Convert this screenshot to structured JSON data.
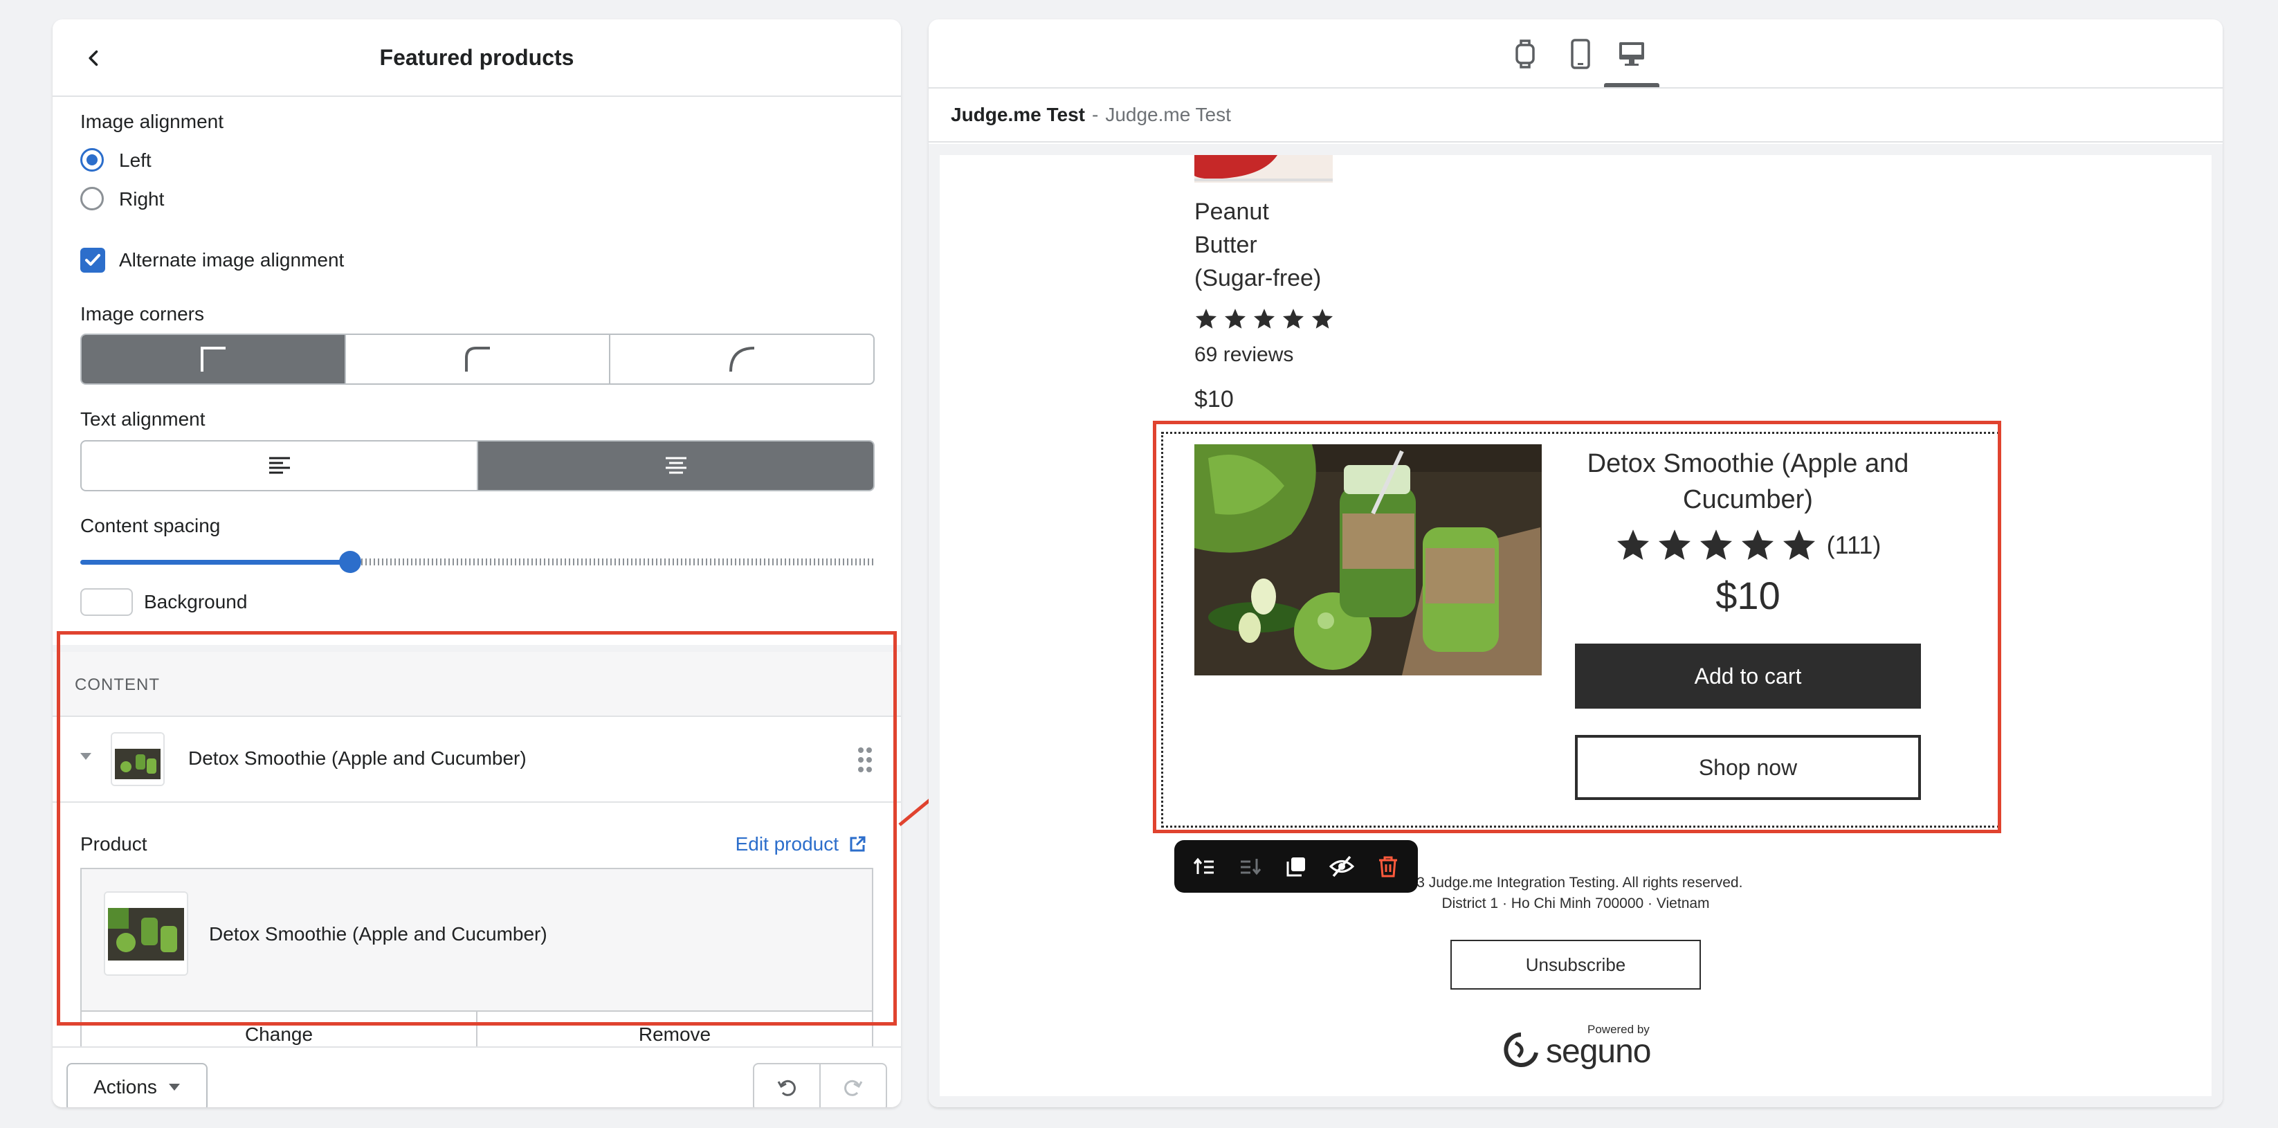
{
  "panel": {
    "title": "Featured products",
    "image_alignment": {
      "label": "Image alignment",
      "options": [
        "Left",
        "Right"
      ],
      "selected": "Left"
    },
    "alternate": {
      "label": "Alternate image alignment",
      "checked": true
    },
    "image_corners": {
      "label": "Image corners",
      "selected": 0
    },
    "text_alignment": {
      "label": "Text alignment",
      "selected": 1
    },
    "content_spacing": {
      "label": "Content spacing",
      "value": 0.34
    },
    "background": {
      "label": "Background",
      "color": "#ffffff"
    },
    "content": {
      "title": "CONTENT",
      "item_name": "Detox Smoothie (Apple and Cucumber)",
      "product_label": "Product",
      "edit_link": "Edit product",
      "card_name": "Detox Smoothie (Apple and Cucumber)",
      "change": "Change",
      "remove": "Remove"
    },
    "footer": {
      "actions": "Actions"
    }
  },
  "preview": {
    "store_name": "Judge.me Test",
    "separator": "-",
    "store_sub": "Judge.me Test",
    "prev_product": {
      "name_lines": [
        "Peanut",
        "Butter",
        "(Sugar-free)"
      ],
      "stars": 5,
      "reviews": "69 reviews",
      "price": "$10"
    },
    "featured": {
      "name": "Detox Smoothie (Apple and Cucumber)",
      "stars": 5,
      "review_count": "(111)",
      "price": "$10",
      "add_to_cart": "Add to cart",
      "shop_now": "Shop now"
    },
    "footer_line1": "23 Judge.me Integration Testing. All rights reserved.",
    "footer_line2": "District 1 · Ho Chi Minh 700000 · Vietnam",
    "unsubscribe": "Unsubscribe",
    "powered_by": "Powered by",
    "brand": "seguno"
  },
  "colors": {
    "accent": "#2c6ecb",
    "highlight": "#e0432f",
    "dark": "#2d2d2d"
  }
}
